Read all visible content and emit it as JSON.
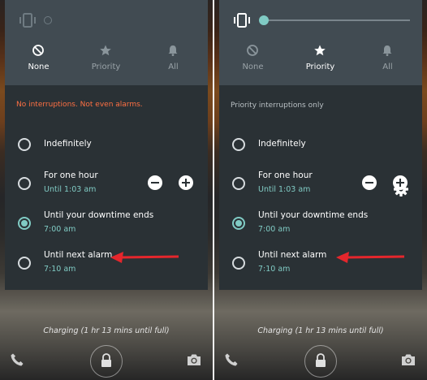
{
  "modes": [
    {
      "label": "None",
      "icon": "block-icon"
    },
    {
      "label": "Priority",
      "icon": "star-icon"
    },
    {
      "label": "All",
      "icon": "bell-icon"
    }
  ],
  "left": {
    "status": "No interruptions. Not even alarms.",
    "active_mode": "None"
  },
  "right": {
    "status": "Priority interruptions only",
    "active_mode": "Priority"
  },
  "options": [
    {
      "title": "Indefinitely",
      "subtitle": ""
    },
    {
      "title": "For one hour",
      "subtitle": "Until 1:03 am"
    },
    {
      "title": "Until your downtime ends",
      "subtitle": "7:00 am"
    },
    {
      "title": "Until next alarm",
      "subtitle": "7:10 am"
    }
  ],
  "selected_option": "Until your downtime ends",
  "lockscreen": {
    "charging": "Charging (1 hr 13 mins until full)"
  },
  "colors": {
    "accent": "#80cbc4",
    "warning": "#ff7043",
    "arrow": "#e5262c"
  }
}
